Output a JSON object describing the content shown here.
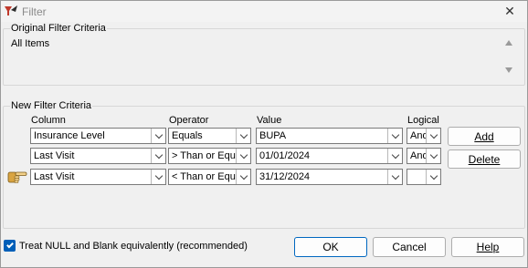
{
  "window": {
    "title": "Filter",
    "close_glyph": "✕"
  },
  "original": {
    "legend": "Original Filter Criteria",
    "text": "All Items"
  },
  "new_criteria": {
    "legend": "New Filter Criteria",
    "headers": {
      "column": "Column",
      "operator": "Operator",
      "value": "Value",
      "logical": "Logical"
    },
    "rows": [
      {
        "column": "Insurance Level",
        "operator": "Equals",
        "value": "BUPA",
        "logical": "And"
      },
      {
        "column": "Last Visit",
        "operator": "> Than or Equa",
        "value": "01/01/2024",
        "logical": "And"
      },
      {
        "column": "Last Visit",
        "operator": "< Than or Equa",
        "value": "31/12/2024",
        "logical": ""
      }
    ],
    "add_label": "Add",
    "delete_label": "Delete"
  },
  "footer": {
    "treat_null_label": "Treat NULL and Blank equivalently (recommended)",
    "treat_null_checked": true,
    "ok_label": "OK",
    "cancel_label": "Cancel",
    "help_label": "Help"
  },
  "icons": {
    "app": "filter-app-icon",
    "close": "close-icon",
    "pointer": "pointing-hand-icon"
  },
  "colors": {
    "accent": "#005fb8",
    "ok_border": "#0067c0"
  }
}
